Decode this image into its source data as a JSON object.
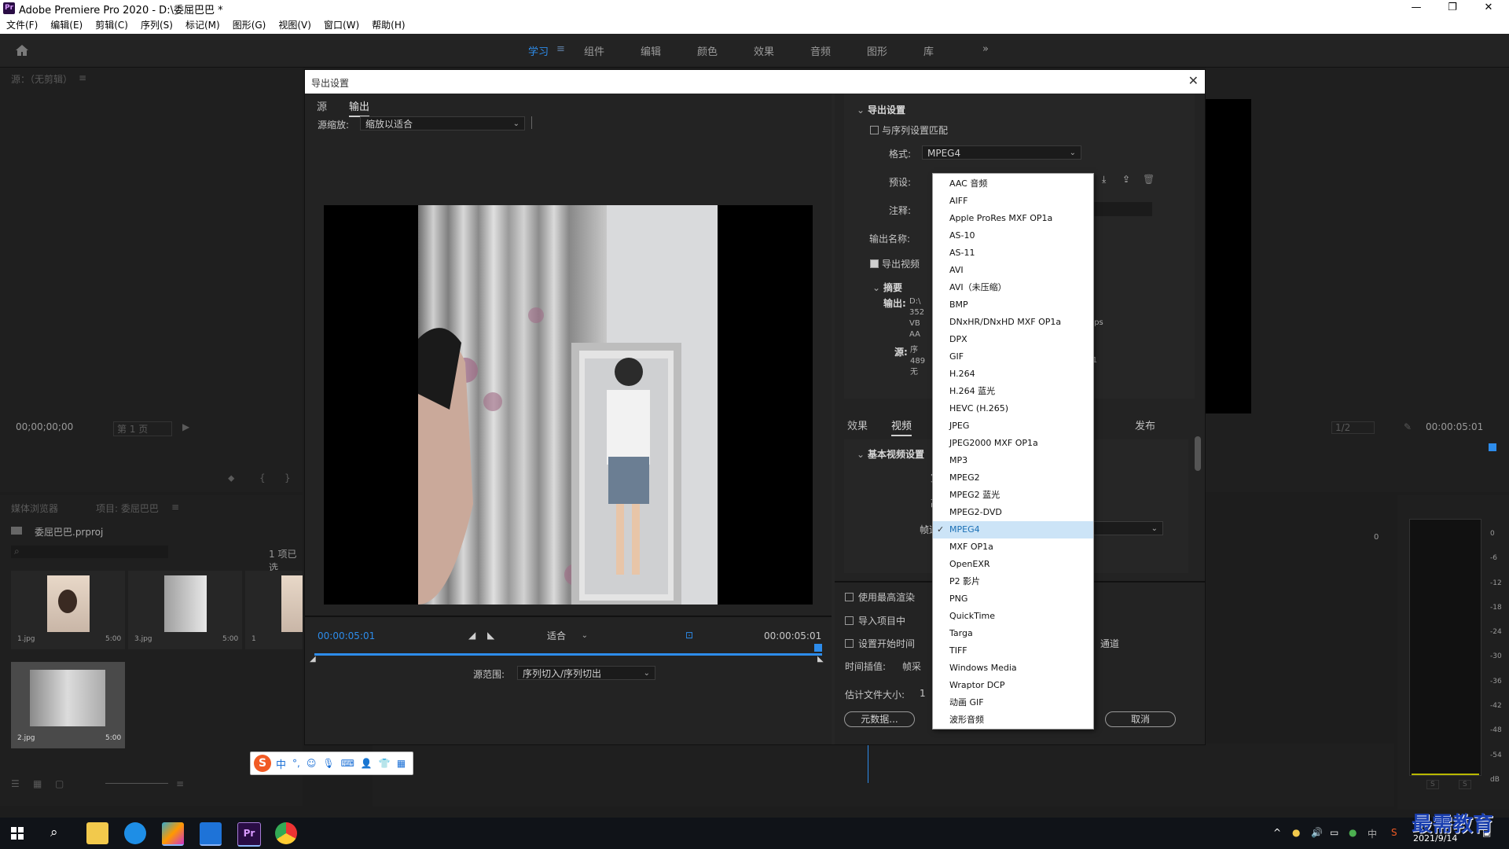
{
  "window": {
    "title": "Adobe Premiere Pro 2020 - D:\\委屈巴巴 *",
    "minimize": "—",
    "restore": "❐",
    "close": "✕"
  },
  "menu": [
    "文件(F)",
    "编辑(E)",
    "剪辑(C)",
    "序列(S)",
    "标记(M)",
    "图形(G)",
    "视图(V)",
    "窗口(W)",
    "帮助(H)"
  ],
  "workspaces": {
    "active": "学习",
    "menu_glyph": "≡",
    "tabs": [
      "组件",
      "编辑",
      "颜色",
      "效果",
      "音频",
      "图形",
      "库"
    ],
    "more": "»"
  },
  "source_panel": {
    "title": "源：（无剪辑）",
    "menu_glyph": "≡",
    "timecode": "00;00;00;00",
    "page": "第 1 页"
  },
  "project_panel": {
    "tab_media": "媒体浏览器",
    "tab_project": "项目: 委屈巴巴",
    "menu_glyph": "≡",
    "project_file": "委屈巴巴.prproj",
    "items_count": "1 项已选",
    "clips": [
      {
        "name": "1.jpg",
        "duration": "5:00"
      },
      {
        "name": "3.jpg",
        "duration": "5:00"
      },
      {
        "name": "1",
        "duration": ""
      },
      {
        "name": "2.jpg",
        "duration": "5:00"
      }
    ]
  },
  "program_panel": {
    "timecode": "00:00:05:01",
    "page": "1/2",
    "meter_top": "0",
    "meter_ticks": [
      "0",
      "-6",
      "-12",
      "-18",
      "-24",
      "-30",
      "-36",
      "-42",
      "-48",
      "-54",
      "dB"
    ],
    "meter_s": [
      "S",
      "S"
    ]
  },
  "dialog": {
    "title": "导出设置",
    "close": "✕",
    "left_tabs": [
      "源",
      "输出"
    ],
    "active_left_tab": "输出",
    "source_scale_label": "源缩放:",
    "source_scale_value": "缩放以适合",
    "preview": {
      "time_start": "00:00:05:01",
      "time_end": "00:00:05:01",
      "fit": "适合",
      "range_label": "源范围:",
      "range_value": "序列切入/序列切出"
    },
    "export_settings": {
      "header": "导出设置",
      "match_sequence": "与序列设置匹配",
      "format_label": "格式:",
      "format_value": "MPEG4",
      "preset_label": "预设:",
      "comment_label": "注释:",
      "output_name_label": "输出名称:",
      "export_video": "导出视频",
      "summary_header": "摘要",
      "summary_output_label": "输出:",
      "summary_output_lines": [
        "D:\\",
        "352",
        "VB",
        "AA"
      ],
      "summary_kbps": "kbps",
      "summary_source_label": "源:",
      "summary_source_lines": [
        "序",
        "489",
        "无"
      ],
      "summary_source_time": ":01"
    },
    "right_tabs": [
      "效果",
      "视频",
      "发布"
    ],
    "active_right_tab": "视频",
    "basic_video_header": "基本视频设置",
    "width_label": "宽",
    "height_label": "高",
    "framerate_label": "帧速",
    "options": {
      "max_render": "使用最高渲染",
      "import_project": "导入项目中",
      "set_start_time": "设置开始时间",
      "channel_suffix": "通道",
      "time_interp_label": "时间插值:",
      "time_interp_value": "帧采",
      "est_size_label": "估计文件大小:",
      "est_size_value": "1"
    },
    "buttons": {
      "metadata": "元数据...",
      "cancel": "取消"
    }
  },
  "dropdown": {
    "selected": "MPEG4",
    "check": "✓",
    "items": [
      "AAC 音频",
      "AIFF",
      "Apple ProRes MXF OP1a",
      "AS-10",
      "AS-11",
      "AVI",
      "AVI（未压缩）",
      "BMP",
      "DNxHR/DNxHD MXF OP1a",
      "DPX",
      "GIF",
      "H.264",
      "H.264 蓝光",
      "HEVC (H.265)",
      "JPEG",
      "JPEG2000 MXF OP1a",
      "MP3",
      "MPEG2",
      "MPEG2 蓝光",
      "MPEG2-DVD",
      "MPEG4",
      "MXF OP1a",
      "OpenEXR",
      "P2 影片",
      "PNG",
      "QuickTime",
      "Targa",
      "TIFF",
      "Windows Media",
      "Wraptor DCP",
      "动画 GIF",
      "波形音频"
    ]
  },
  "ime": {
    "logo": "S",
    "mode": "中"
  },
  "taskbar": {
    "date": "2021/9/14"
  },
  "watermark": "最需教育",
  "colors": {
    "accent_blue": "#2d8ceb",
    "dialog_bg": "#262626",
    "dropdown_sel": "#cce4f7"
  }
}
